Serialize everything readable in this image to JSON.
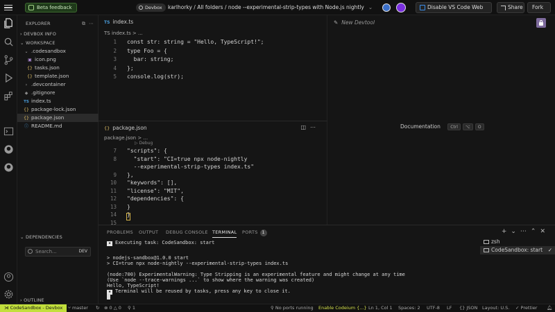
{
  "topbar": {
    "beta_label": "Beta feedback",
    "devbox_label": "Devbox",
    "breadcrumb": "karlhorky / All folders / node --experimental-strip-types with Node.js nightly",
    "avatar_initial": "",
    "avatar2_initial": "",
    "vscode_label": "Disable VS Code Web",
    "vscode_caret": "⌄",
    "share_label": "Share",
    "fork_label": "Fork",
    "fork_caret": "⌄"
  },
  "sidebar": {
    "explorer_label": "EXPLORER",
    "devbox_info_label": "DEVBOX INFO",
    "workspace_label": "WORKSPACE",
    "items": [
      {
        "label": ".codesandbox",
        "type": "folder"
      },
      {
        "label": "icon.png",
        "type": "file"
      },
      {
        "label": "tasks.json",
        "type": "json"
      },
      {
        "label": "template.json",
        "type": "json"
      },
      {
        "label": ".devcontainer",
        "type": "folder"
      },
      {
        "label": ".gitignore",
        "type": "file"
      },
      {
        "label": "index.ts",
        "type": "ts"
      },
      {
        "label": "package-lock.json",
        "type": "json"
      },
      {
        "label": "package.json",
        "type": "json"
      },
      {
        "label": "README.md",
        "type": "md"
      }
    ],
    "dependencies_label": "DEPENDENCIES",
    "search_placeholder": "Search...",
    "search_tag": "DEV",
    "outline_label": "OUTLINE"
  },
  "editor_top": {
    "tab_label": "index.ts",
    "tab_icon": "TS",
    "breadcrumb": "TS index.ts > ...",
    "lines": [
      {
        "n": "1",
        "code": "const str: string = \"Hello, TypeScript!\";"
      },
      {
        "n": "2",
        "code": "type Foo = {"
      },
      {
        "n": "3",
        "code": "  bar: string;"
      },
      {
        "n": "4",
        "code": "};"
      },
      {
        "n": "5",
        "code": "console.log(str);"
      }
    ]
  },
  "editor_bot": {
    "tab_label": "package.json",
    "tab_icon": "{}",
    "breadcrumb": "package.json > ...",
    "debug_hint": "▷ Debug",
    "lines": [
      {
        "n": "7",
        "code": "\"scripts\": {"
      },
      {
        "n": "8",
        "code": "  \"start\": \"CI=true npx node-nightly"
      },
      {
        "n": "",
        "code": "  --experimental-strip-types index.ts\""
      },
      {
        "n": "9",
        "code": "},"
      },
      {
        "n": "10",
        "code": "\"keywords\": [],"
      },
      {
        "n": "11",
        "code": "\"license\": \"MIT\","
      },
      {
        "n": "12",
        "code": "\"dependencies\": {"
      },
      {
        "n": "13",
        "code": "}"
      },
      {
        "n": "14",
        "code": "}"
      },
      {
        "n": "15",
        "code": ""
      }
    ]
  },
  "devtool": {
    "title": "New Devtool",
    "doc_label": "Documentation",
    "kbd1": "Ctrl",
    "kbd2": "⌥",
    "kbd3": "O"
  },
  "panel": {
    "tabs": [
      "PROBLEMS",
      "OUTPUT",
      "DEBUG CONSOLE",
      "TERMINAL",
      "PORTS"
    ],
    "ports_count": "1",
    "terminal_lines": [
      "Executing task: CodeSandbox: start",
      "",
      "> nodejs-sandbox@1.0.0 start",
      "> CI=true npx node-nightly --experimental-strip-types index.ts",
      "",
      "(node:700) ExperimentalWarning: Type Stripping is an experimental feature and might change at any time",
      "(Use `node --trace-warnings ...` to show where the warning was created)",
      "Hello, TypeScript!",
      "Terminal will be reused by tasks, press any key to close it."
    ],
    "terminals": [
      {
        "label": "zsh"
      },
      {
        "label": "CodeSandbox: start"
      }
    ]
  },
  "statusbar": {
    "remote": "CodeSandbox - Devbox",
    "branch": "master",
    "sync": "↻",
    "errors": "⊗ 0 △ 0",
    "ports": "1",
    "no_ports": "No ports running",
    "codeium": "Enable Codeium {...}",
    "position": "Ln 1, Col 1",
    "spaces": "Spaces: 2",
    "encoding": "UTF-8",
    "eol": "LF",
    "language": "{} JSON",
    "layout": "Layout: U.S.",
    "prettier": "✓ Prettier"
  },
  "colors": {
    "accent": "#c2df3c",
    "lock_button": "#7d6a9c",
    "avatar2": "#7a2fe0"
  }
}
